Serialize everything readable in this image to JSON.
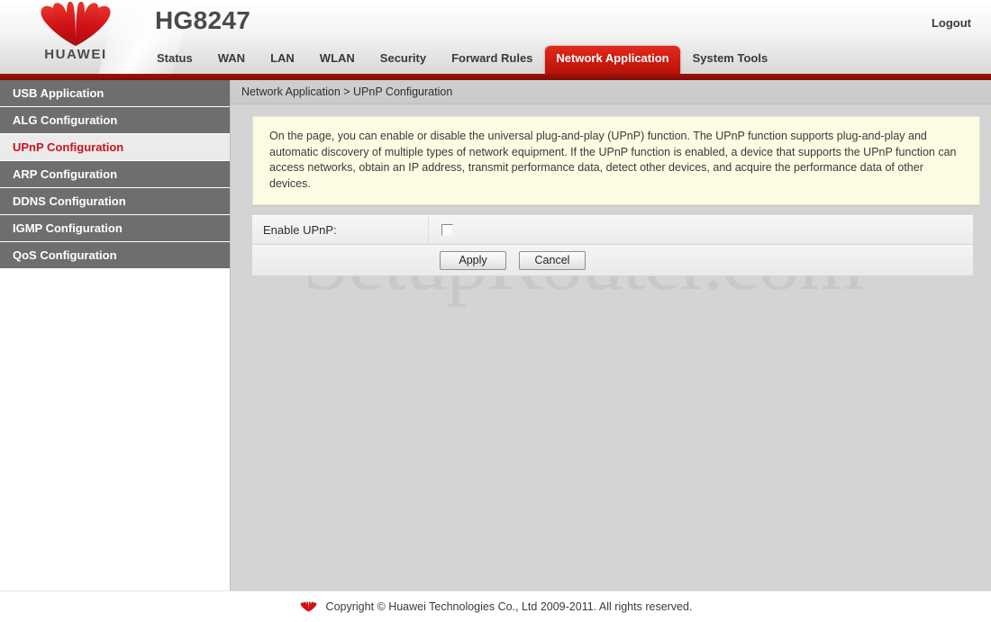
{
  "header": {
    "brand_word": "HUAWEI",
    "brand_icon": "huawei-flower-logo",
    "model": "HG8247",
    "logout_label": "Logout",
    "accent_red": "#c8141b",
    "bar_red": "#8d0f06"
  },
  "tabs": [
    {
      "label": "Status",
      "active": false
    },
    {
      "label": "WAN",
      "active": false
    },
    {
      "label": "LAN",
      "active": false
    },
    {
      "label": "WLAN",
      "active": false
    },
    {
      "label": "Security",
      "active": false
    },
    {
      "label": "Forward Rules",
      "active": false
    },
    {
      "label": "Network Application",
      "active": true
    },
    {
      "label": "System Tools",
      "active": false
    }
  ],
  "sidebar": {
    "items": [
      {
        "label": "USB Application",
        "active": false
      },
      {
        "label": "ALG Configuration",
        "active": false
      },
      {
        "label": "UPnP Configuration",
        "active": true
      },
      {
        "label": "ARP Configuration",
        "active": false
      },
      {
        "label": "DDNS Configuration",
        "active": false
      },
      {
        "label": "IGMP Configuration",
        "active": false
      },
      {
        "label": "QoS Configuration",
        "active": false
      }
    ]
  },
  "content": {
    "breadcrumb": "Network Application > UPnP Configuration",
    "info_text": "On the page, you can enable or disable the universal plug-and-play (UPnP) function. The UPnP function supports plug-and-play and automatic discovery of multiple types of network equipment. If the UPnP function is enabled, a device that supports the UPnP function can access networks, obtain an IP address, transmit performance data, detect other devices, and acquire the performance data of other devices.",
    "info_bg": "#fcfbe3",
    "form": {
      "enable_upnp_label": "Enable UPnP:",
      "enable_upnp_checked": false
    },
    "apply_label": "Apply",
    "cancel_label": "Cancel",
    "watermark": "SetupRouter.com"
  },
  "footer": {
    "logo_icon": "huawei-flower-logo",
    "copyright": "Copyright © Huawei Technologies Co., Ltd 2009-2011. All rights reserved."
  }
}
